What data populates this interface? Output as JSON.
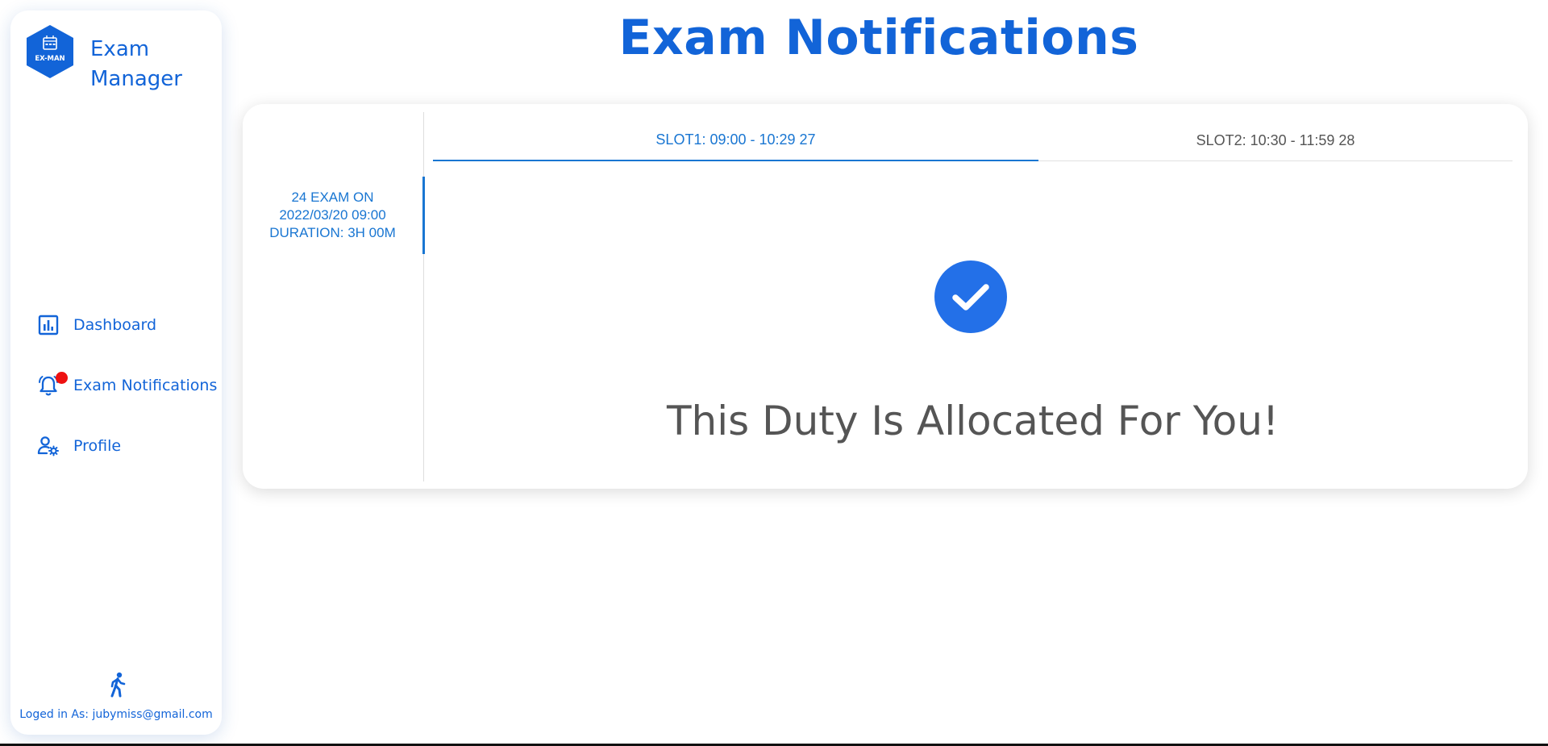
{
  "sidebar": {
    "logo_text": "EX-MAN",
    "brand_line1": "Exam",
    "brand_line2": "Manager",
    "items": [
      {
        "label": "Dashboard",
        "icon": "dashboard-icon"
      },
      {
        "label": "Exam Notifications",
        "icon": "bell-icon"
      },
      {
        "label": "Profile",
        "icon": "user-settings-icon"
      }
    ],
    "logout_icon": "walking-person-icon",
    "logged_in_text": "Loged in As: jubymiss@gmail.com"
  },
  "page": {
    "title": "Exam Notifications"
  },
  "exam_list": [
    {
      "line1": "24 EXAM ON",
      "line2": "2022/03/20 09:00",
      "line3": "DURATION: 3H 00M"
    }
  ],
  "tabs": [
    {
      "label": "SLOT1: 09:00 - 10:29 27",
      "active": true
    },
    {
      "label": "SLOT2: 10:30 - 11:59 28",
      "active": false
    }
  ],
  "content": {
    "status_icon": "check-circle-icon",
    "message": "This Duty Is Allocated For You!"
  },
  "colors": {
    "accent": "#1264d8",
    "tab_accent": "#1976d2",
    "notification_dot": "#ee1111",
    "text_muted": "#555555"
  }
}
